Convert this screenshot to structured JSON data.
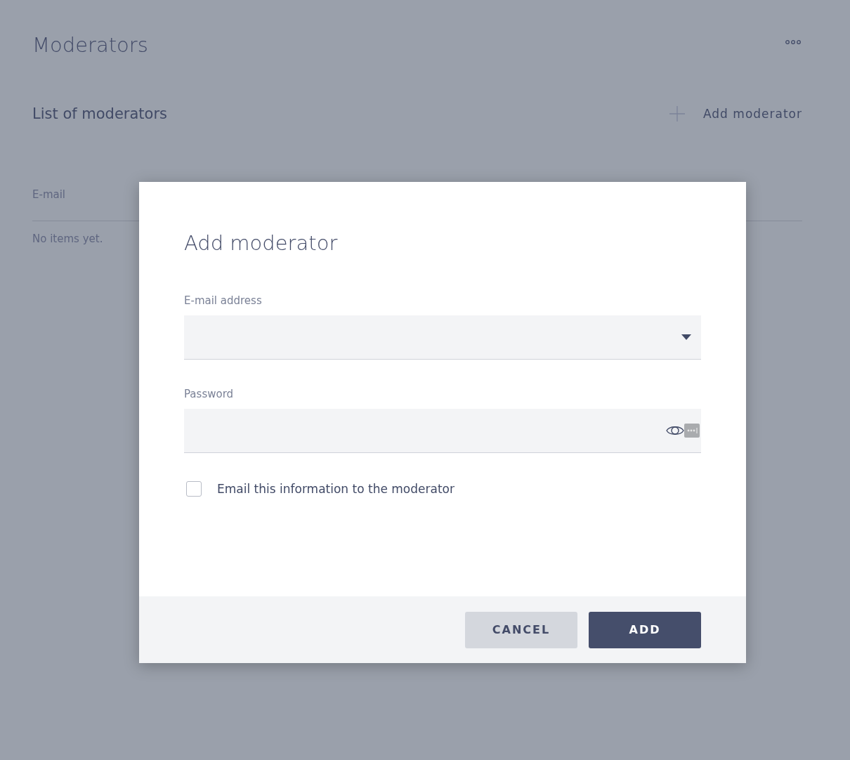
{
  "page": {
    "title": "Moderators",
    "section_title": "List of moderators",
    "add_action": "Add moderator",
    "table": {
      "columns": [
        "E-mail"
      ],
      "empty_text": "No items yet."
    }
  },
  "dialog": {
    "title": "Add moderator",
    "fields": [
      {
        "kind": "select",
        "label": "E-mail address"
      },
      {
        "kind": "password",
        "label": "Password"
      }
    ],
    "checkbox": {
      "label": "Email this information to the moderator",
      "checked": false
    },
    "buttons": [
      {
        "kind": "secondary",
        "label": "CANCEL"
      },
      {
        "kind": "primary",
        "label": "ADD"
      }
    ]
  }
}
